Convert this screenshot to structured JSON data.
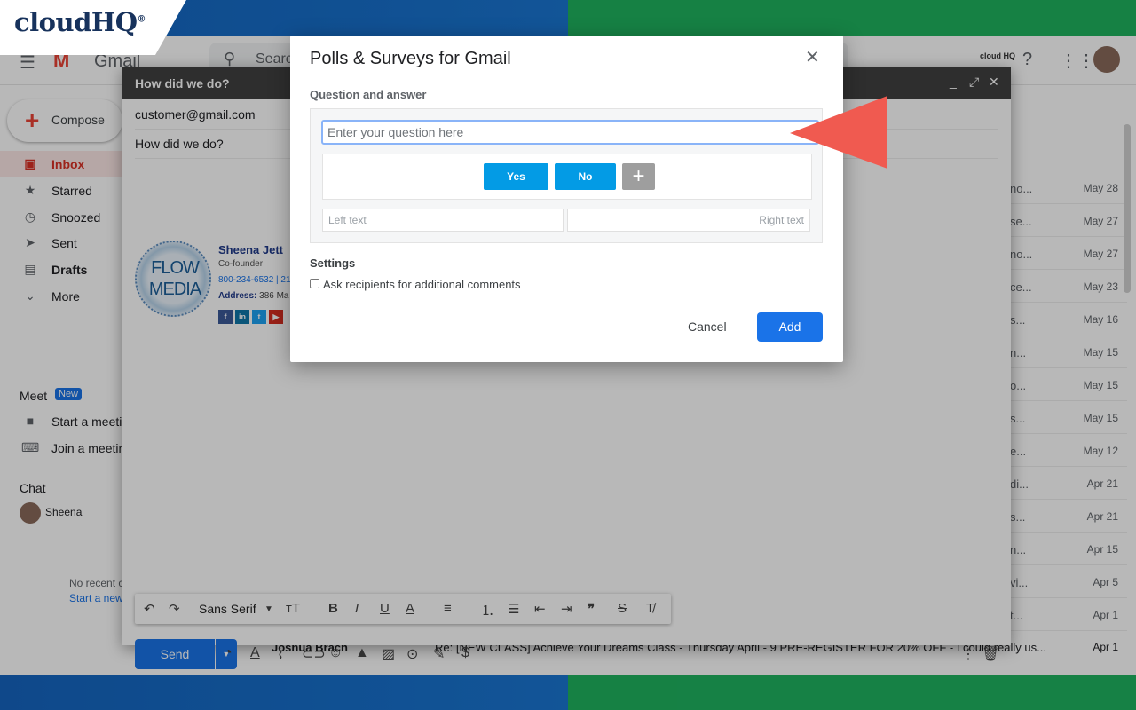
{
  "brand": {
    "name": "cloudHQ",
    "mark": "®"
  },
  "gmail": {
    "brand": "Gmail",
    "search_placeholder": "Search mail",
    "cloudhq_top": "cloud HQ",
    "compose_label": "Compose",
    "sidebar": [
      {
        "label": "Inbox",
        "icon": "inbox-icon"
      },
      {
        "label": "Starred",
        "icon": "star-icon"
      },
      {
        "label": "Snoozed",
        "icon": "clock-icon"
      },
      {
        "label": "Sent",
        "icon": "send-icon"
      },
      {
        "label": "Drafts",
        "icon": "draft-icon"
      },
      {
        "label": "More",
        "icon": "chevron-down-icon"
      }
    ],
    "meet": {
      "title": "Meet",
      "badge": "New",
      "start": "Start a meeting",
      "join": "Join a meeting"
    },
    "chat": {
      "title": "Chat",
      "user": "Sheena",
      "no_recent": "No recent chats",
      "start_new": "Start a new one"
    },
    "mail_rows": [
      {
        "snippet": "no...",
        "date": "May 28"
      },
      {
        "snippet": "se...",
        "date": "May 27"
      },
      {
        "snippet": "no...",
        "date": "May 27"
      },
      {
        "snippet": "ce...",
        "date": "May 23"
      },
      {
        "snippet": "s...",
        "date": "May 16"
      },
      {
        "snippet": "n...",
        "date": "May 15"
      },
      {
        "snippet": "o...",
        "date": "May 15"
      },
      {
        "snippet": "s...",
        "date": "May 15"
      },
      {
        "snippet": "e...",
        "date": "May 12"
      },
      {
        "snippet": "di...",
        "date": "Apr 21"
      },
      {
        "snippet": "s...",
        "date": "Apr 21"
      },
      {
        "snippet": "n...",
        "date": "Apr 15"
      },
      {
        "snippet": "vi...",
        "date": "Apr 5"
      },
      {
        "snippet": "t...",
        "date": "Apr 1"
      }
    ],
    "last_row": {
      "from": "Joshua Brach",
      "subject": "Re: [NEW CLASS] Achieve Your Dreams Class - Thursday April - 9 PRE-REGISTER FOR 20% OFF - I could really us...",
      "date": "Apr 1"
    }
  },
  "compose": {
    "title": "How did we do?",
    "to": "customer@gmail.com",
    "subject": "How did we do?",
    "signature": {
      "logo_line1": "FLOW",
      "logo_line2": "MEDIA",
      "name": "Sheena Jett",
      "role": "Co-founder",
      "phone": "800-234-6532 | 21",
      "address_label": "Address:",
      "address": "386 Ma"
    },
    "font": "Sans Serif",
    "send_label": "Send"
  },
  "dialog": {
    "title": "Polls & Surveys for Gmail",
    "section_qa": "Question and answer",
    "question_placeholder": "Enter your question here",
    "answers": [
      "Yes",
      "No"
    ],
    "add_answer": "+",
    "left_placeholder": "Left text",
    "right_placeholder": "Right text",
    "section_settings": "Settings",
    "checkbox_label": "Ask recipients for additional comments",
    "cancel_label": "Cancel",
    "add_label": "Add"
  },
  "colors": {
    "accent": "#1a73e8",
    "answer_button": "#039be5",
    "pointer_arrow": "#f05a50",
    "band_blue": "#1976d2",
    "band_green": "#1fb35f"
  }
}
